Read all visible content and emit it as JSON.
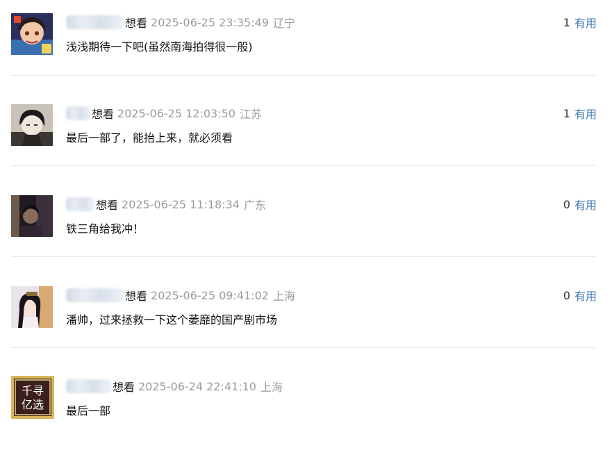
{
  "comments": [
    {
      "status": "想看",
      "time": "2025-06-25 23:35:49",
      "location": "辽宁",
      "votes": "1",
      "useful_label": "有用",
      "text": "浅浅期待一下吧(虽然南海拍得很一般)",
      "avatar_icon": "anime-girl-avatar-icon"
    },
    {
      "status": "想看",
      "time": "2025-06-25 12:03:50",
      "location": "江苏",
      "votes": "1",
      "useful_label": "有用",
      "text": "最后一部了，能抬上来，就必须看",
      "avatar_icon": "dark-hair-boy-avatar-icon"
    },
    {
      "status": "想看",
      "time": "2025-06-25 11:18:34",
      "location": "广东",
      "votes": "0",
      "useful_label": "有用",
      "text": "铁三角给我冲！",
      "avatar_icon": "dark-scene-avatar-icon"
    },
    {
      "status": "想看",
      "time": "2025-06-25 09:41:02",
      "location": "上海",
      "votes": "0",
      "useful_label": "有用",
      "text": "潘帅，过来拯救一下这个萎靡的国产剧市场",
      "avatar_icon": "costume-lady-avatar-icon"
    },
    {
      "status": "想看",
      "time": "2025-06-24 22:41:10",
      "location": "上海",
      "text": "最后一部",
      "avatar_icon": "qianxun-yixuan-logo-icon",
      "avatar_text": [
        "千寻",
        "亿选"
      ]
    }
  ]
}
